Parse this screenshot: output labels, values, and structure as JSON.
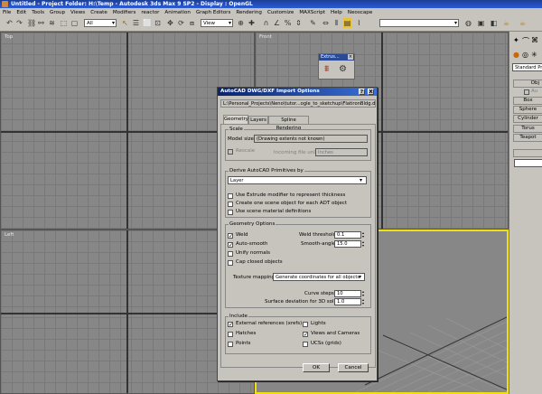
{
  "window": {
    "title": "Untitled    - Project Folder: H:\\Temp    - Autodesk 3ds Max 9 SP2     - Display : OpenGL"
  },
  "menu": [
    "File",
    "Edit",
    "Tools",
    "Group",
    "Views",
    "Create",
    "Modifiers",
    "reactor",
    "Animation",
    "Graph Editors",
    "Rendering",
    "Customize",
    "MAXScript",
    "Help",
    "Neoscape"
  ],
  "toolbar": {
    "filter": "All",
    "refcoord": "View"
  },
  "viewports": {
    "top": "Top",
    "front": "Front",
    "left": "Left"
  },
  "extrude_toolbar": {
    "title": "Extrus..."
  },
  "command_panel": {
    "dropdown": "Standard Pri",
    "rollout": "Obj",
    "autogrid": "Au",
    "buttons": [
      "Box",
      "Sphere",
      "Cylinder",
      "Torus",
      "Teapot"
    ]
  },
  "dialog": {
    "title": "AutoCAD DWG/DXF Import Options",
    "help_btn": "?",
    "close_btn": "X",
    "filepath": "L:\\Personal_Projects\\Neno\\tutor...ogle_to_sketchup\\FlatironBldg.dwg",
    "tabs": [
      "Geometry",
      "Layers",
      "Spline Rendering"
    ],
    "scale": {
      "label": "Scale",
      "model_size_label": "Model size:",
      "model_size_value": "(Drawing extents not known)",
      "rescale": "Rescale",
      "units_label": "Incoming file units:",
      "units_value": "Inches"
    },
    "derive": {
      "label": "Derive AutoCAD Primitives by",
      "value": "Layer",
      "options": [
        "Use Extrude modifier to represent thickness",
        "Create one scene object for each ADT object",
        "Use scene material definitions"
      ]
    },
    "geometry": {
      "label": "Geometry Options",
      "weld": "Weld",
      "weld_threshold_label": "Weld threshold:",
      "weld_threshold": "0.1",
      "autosmooth": "Auto-smooth",
      "smooth_angle_label": "Smooth-angle:",
      "smooth_angle": "15.0",
      "unify": "Unify normals",
      "cap": "Cap closed objects",
      "texture_label": "Texture mapping:",
      "texture_value": "Generate coordinates for all objects",
      "curve_steps_label": "Curve steps:",
      "curve_steps": "10",
      "surface_dev_label": "Surface deviation for 3D solids:",
      "surface_dev": "1.0"
    },
    "include": {
      "label": "Include",
      "xrefs": "External references (xrefs)",
      "lights": "Lights",
      "hatches": "Hatches",
      "views": "Views and Cameras",
      "points": "Points",
      "ucs": "UCSs (grids)"
    },
    "ok": "OK",
    "cancel": "Cancel"
  }
}
